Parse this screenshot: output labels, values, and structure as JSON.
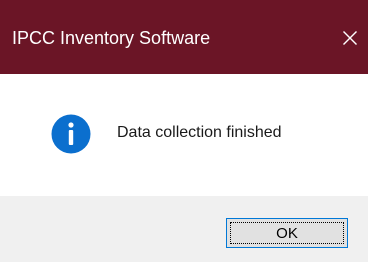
{
  "window": {
    "title": "IPCC Inventory Software",
    "close_icon": "close-icon",
    "titlebar_color": "#6b1526"
  },
  "message": {
    "icon": "info-icon",
    "icon_color": "#0b6fce",
    "text": "Data collection finished"
  },
  "buttons": {
    "ok_label": "OK"
  }
}
